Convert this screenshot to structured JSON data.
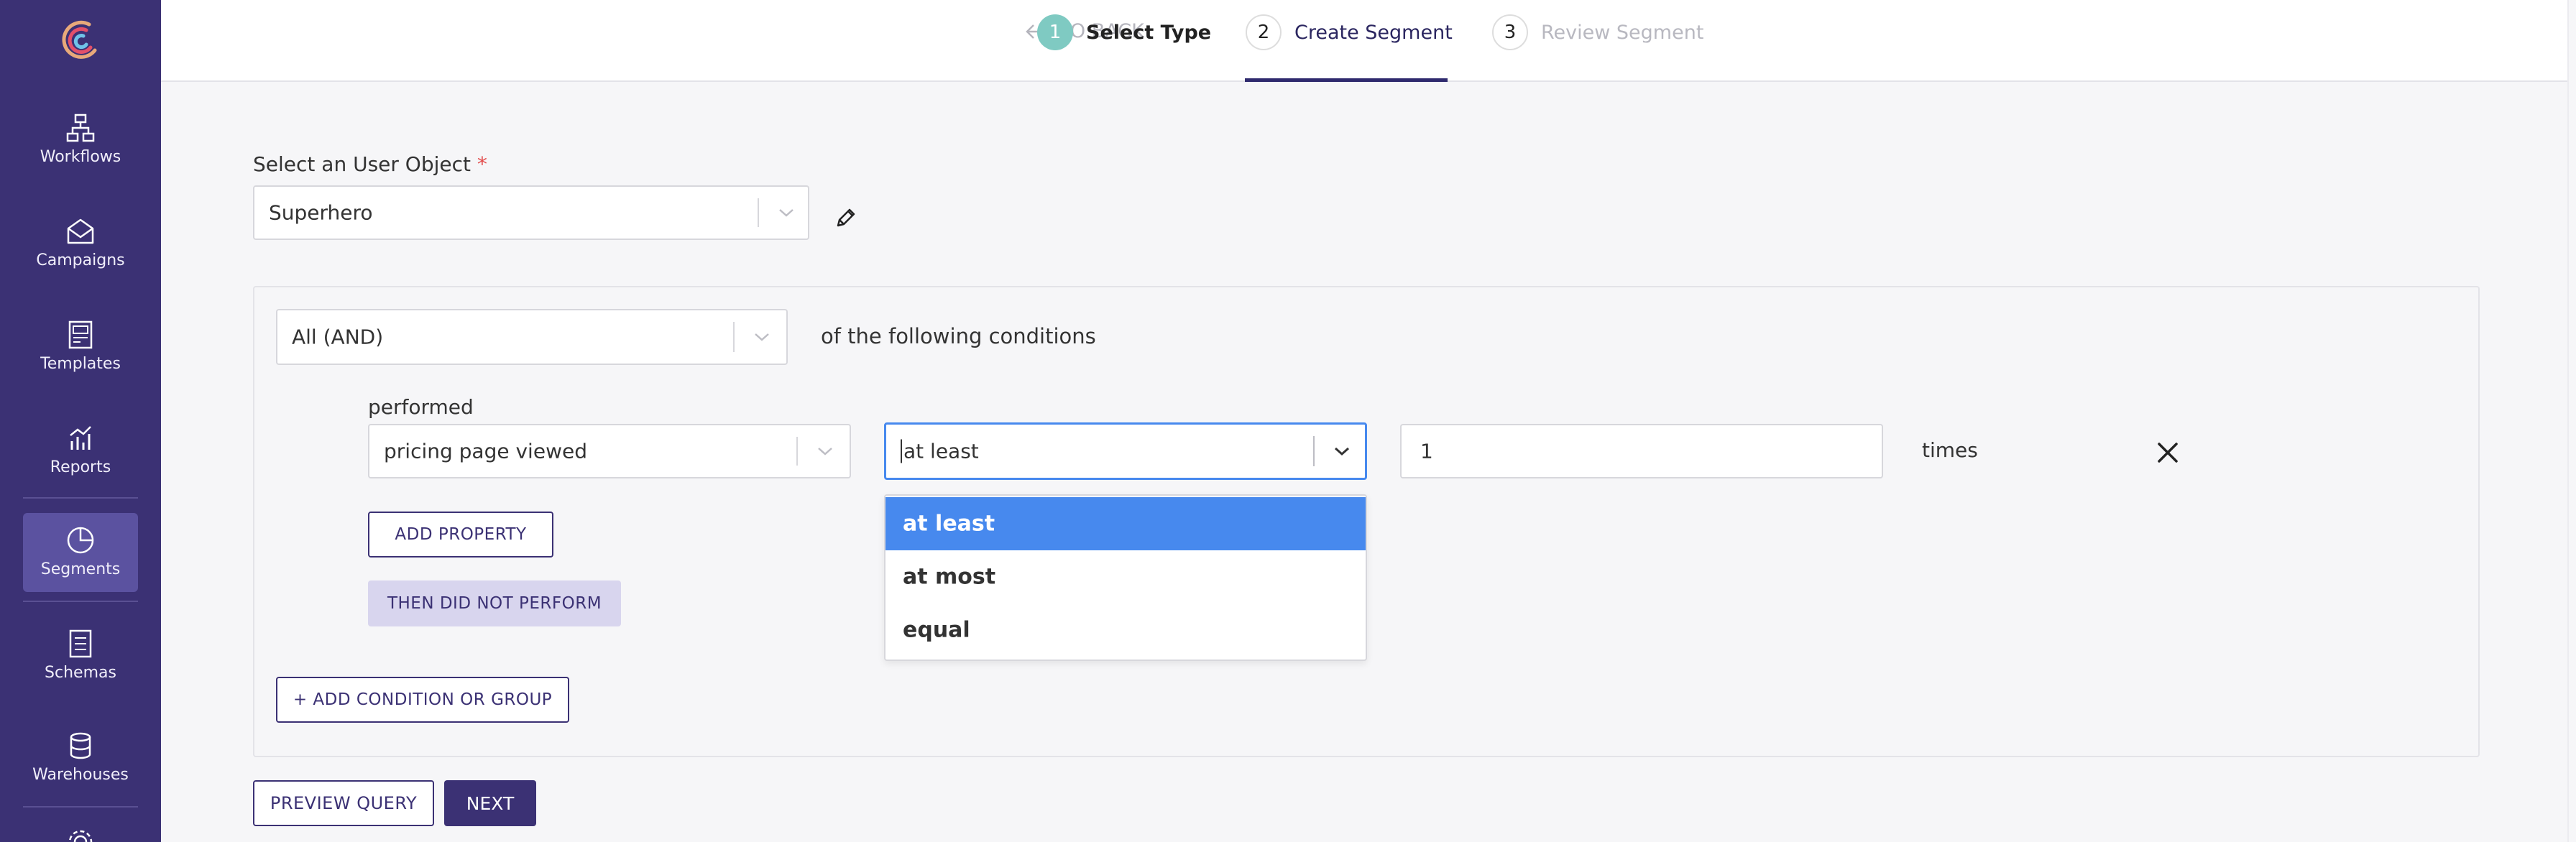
{
  "colors": {
    "sidebar": "#3b3174",
    "accent": "#3b3174",
    "step_active": "#7fcac2",
    "option_selected": "#4789ee"
  },
  "sidebar": {
    "items": [
      {
        "label": "Workflows",
        "icon": "workflow-icon"
      },
      {
        "label": "Campaigns",
        "icon": "envelope-icon"
      },
      {
        "label": "Templates",
        "icon": "template-icon"
      },
      {
        "label": "Reports",
        "icon": "chart-icon"
      },
      {
        "label": "Segments",
        "icon": "pie-chart-icon",
        "active": true
      },
      {
        "label": "Schemas",
        "icon": "document-icon"
      },
      {
        "label": "Warehouses",
        "icon": "database-icon"
      }
    ]
  },
  "header": {
    "go_back": "GO BACK",
    "steps": [
      {
        "num": "1",
        "label": "Select Type"
      },
      {
        "num": "2",
        "label": "Create Segment"
      },
      {
        "num": "3",
        "label": "Review Segment"
      }
    ]
  },
  "user_object": {
    "label": "Select an User Object",
    "required_mark": "*",
    "value": "Superhero"
  },
  "conditions": {
    "combinator": "All (AND)",
    "suffix": "of the following conditions",
    "event_label": "performed",
    "event_value": "pricing page viewed",
    "operator_value": "at least",
    "count_value": "1",
    "times_label": "times",
    "add_property": "ADD PROPERTY",
    "then_did_not": "THEN DID NOT PERFORM",
    "operator_options": [
      "at least",
      "at most",
      "equal"
    ],
    "add_condition": "+ ADD CONDITION OR GROUP"
  },
  "footer": {
    "preview": "PREVIEW QUERY",
    "next": "NEXT"
  }
}
